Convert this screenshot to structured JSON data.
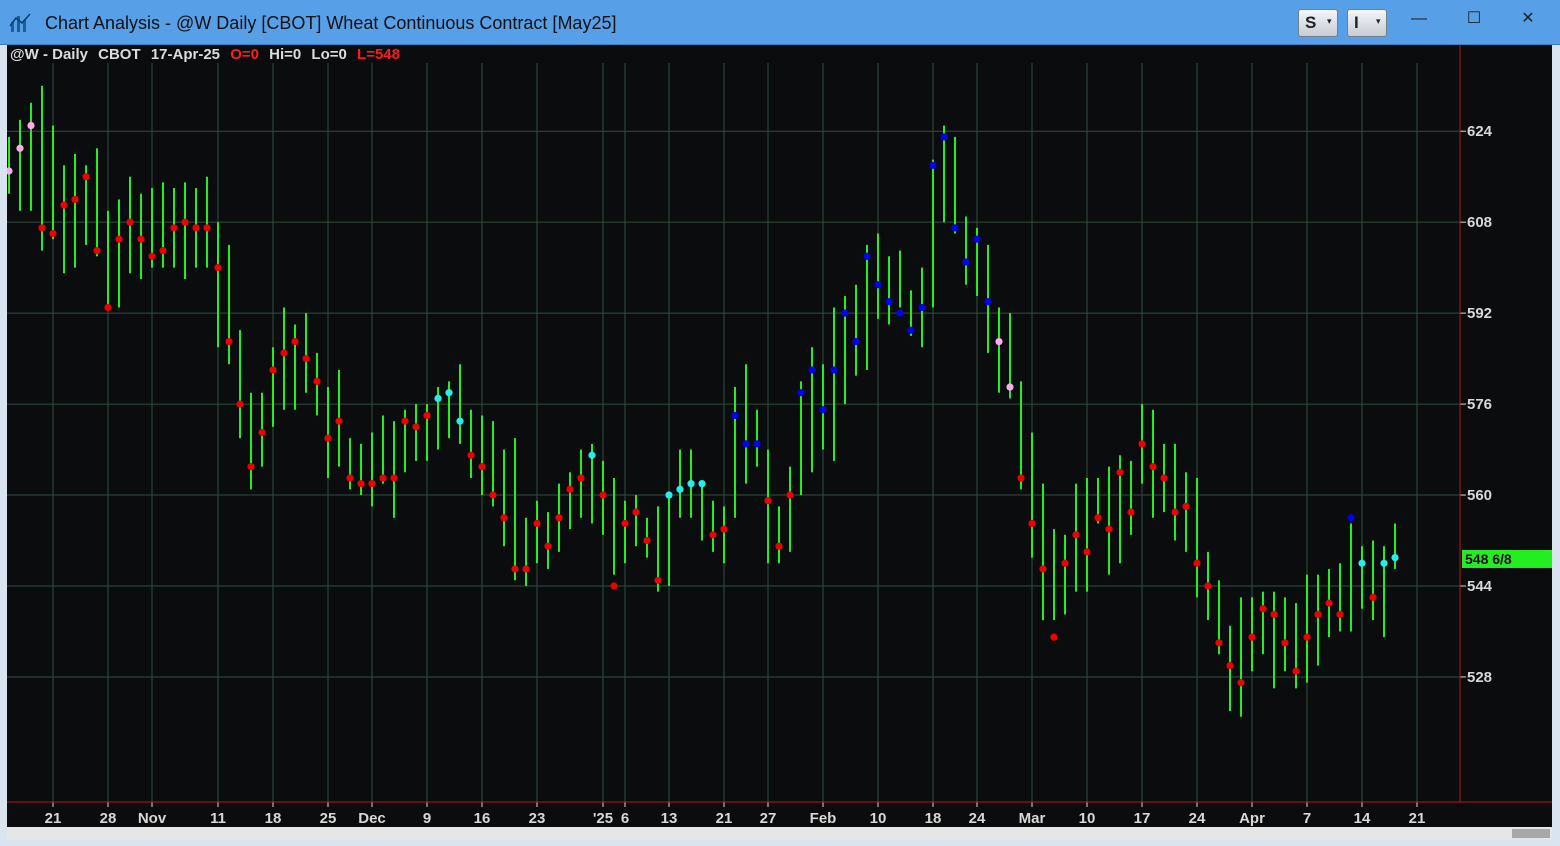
{
  "window": {
    "title": "Chart Analysis - @W Daily [CBOT] Wheat Continuous Contract [May25]",
    "toolbar_s_label": "S",
    "toolbar_i_label": "I",
    "caret": "▾",
    "minimize": "—",
    "maximize": "☐",
    "close": "✕"
  },
  "status": {
    "symbol": "@W - Daily",
    "exchange": "CBOT",
    "date": "17-Apr-25",
    "open": "O=0",
    "high": "Hi=0",
    "low": "Lo=0",
    "last": "L=548"
  },
  "colors": {
    "background": "#0b0c0d",
    "grid": "#2f4f3e",
    "bar": "#22ee22",
    "dot_red": "#ee0000",
    "dot_blue": "#0000ee",
    "dot_cyan": "#22eeee",
    "dot_pink": "#ffaaee",
    "axis_text": "#d8d8d8",
    "price_marker": "#22ee22",
    "axis_line": "#c01020"
  },
  "chart_data": {
    "type": "ohlc-bar",
    "title": "",
    "ylim": [
      506,
      636
    ],
    "y_ticks": [
      528,
      544,
      560,
      576,
      592,
      608,
      624
    ],
    "x_tick_labels": [
      {
        "label": "21",
        "bar": 4
      },
      {
        "label": "28",
        "bar": 9
      },
      {
        "label": "Nov",
        "bar": 13
      },
      {
        "label": "11",
        "bar": 19
      },
      {
        "label": "18",
        "bar": 24
      },
      {
        "label": "25",
        "bar": 29
      },
      {
        "label": "Dec",
        "bar": 33
      },
      {
        "label": "9",
        "bar": 38
      },
      {
        "label": "16",
        "bar": 43
      },
      {
        "label": "23",
        "bar": 48
      },
      {
        "label": "'25",
        "bar": 54
      },
      {
        "label": "6",
        "bar": 56
      },
      {
        "label": "13",
        "bar": 60
      },
      {
        "label": "21",
        "bar": 65
      },
      {
        "label": "27",
        "bar": 69
      },
      {
        "label": "Feb",
        "bar": 74
      },
      {
        "label": "10",
        "bar": 79
      },
      {
        "label": "18",
        "bar": 84
      },
      {
        "label": "24",
        "bar": 88
      },
      {
        "label": "Mar",
        "bar": 93
      },
      {
        "label": "10",
        "bar": 98
      },
      {
        "label": "17",
        "bar": 103
      },
      {
        "label": "24",
        "bar": 108
      },
      {
        "label": "Apr",
        "bar": 113
      },
      {
        "label": "7",
        "bar": 118
      },
      {
        "label": "14",
        "bar": 123
      },
      {
        "label": "21",
        "bar": 128
      }
    ],
    "last_price_label": "548 6/8",
    "last_price": 548.75,
    "bars": [
      [
        623,
        613,
        617,
        "pink"
      ],
      [
        626,
        610,
        621,
        "pink"
      ],
      [
        629,
        610,
        625,
        "pink"
      ],
      [
        632,
        603,
        607,
        "red"
      ],
      [
        625,
        605,
        606,
        "red"
      ],
      [
        618,
        599,
        611,
        "red"
      ],
      [
        620,
        600,
        612,
        "red"
      ],
      [
        618,
        604,
        616,
        "red"
      ],
      [
        621,
        602,
        603,
        "red"
      ],
      [
        610,
        593,
        593,
        "red"
      ],
      [
        612,
        593,
        605,
        "red"
      ],
      [
        616,
        599,
        608,
        "red"
      ],
      [
        613,
        598,
        605,
        "red"
      ],
      [
        614,
        600,
        602,
        "red"
      ],
      [
        615,
        600,
        603,
        "red"
      ],
      [
        614,
        600,
        607,
        "red"
      ],
      [
        615,
        598,
        608,
        "red"
      ],
      [
        614,
        600,
        607,
        "red"
      ],
      [
        616,
        600,
        607,
        "red"
      ],
      [
        608,
        586,
        600,
        "red"
      ],
      [
        604,
        583,
        587,
        "red"
      ],
      [
        589,
        570,
        576,
        "red"
      ],
      [
        578,
        561,
        565,
        "red"
      ],
      [
        578,
        565,
        571,
        "red"
      ],
      [
        586,
        572,
        582,
        "red"
      ],
      [
        593,
        575,
        585,
        "red"
      ],
      [
        590,
        575,
        587,
        "red"
      ],
      [
        592,
        578,
        584,
        "red"
      ],
      [
        585,
        574,
        580,
        "red"
      ],
      [
        579,
        563,
        570,
        "red"
      ],
      [
        582,
        565,
        573,
        "red"
      ],
      [
        570,
        561,
        563,
        "red"
      ],
      [
        569,
        560,
        562,
        "red"
      ],
      [
        571,
        558,
        562,
        "red"
      ],
      [
        574,
        562,
        563,
        "red"
      ],
      [
        573,
        556,
        563,
        "red"
      ],
      [
        575,
        564,
        573,
        "red"
      ],
      [
        576,
        566,
        572,
        "red"
      ],
      [
        576,
        566,
        574,
        "red"
      ],
      [
        579,
        568,
        577,
        "cyan"
      ],
      [
        580,
        570,
        578,
        "cyan"
      ],
      [
        583,
        569,
        573,
        "cyan"
      ],
      [
        575,
        563,
        567,
        "red"
      ],
      [
        574,
        560,
        565,
        "red"
      ],
      [
        573,
        558,
        560,
        "red"
      ],
      [
        568,
        551,
        556,
        "red"
      ],
      [
        570,
        545,
        547,
        "red"
      ],
      [
        556,
        544,
        547,
        "red"
      ],
      [
        559,
        548,
        555,
        "red"
      ],
      [
        557,
        547,
        551,
        "red"
      ],
      [
        562,
        550,
        556,
        "red"
      ],
      [
        564,
        554,
        561,
        "red"
      ],
      [
        568,
        556,
        563,
        "red"
      ],
      [
        569,
        555,
        567,
        "cyan"
      ],
      [
        566,
        553,
        560,
        "red"
      ],
      [
        563,
        546,
        544,
        "red"
      ],
      [
        559,
        548,
        555,
        "red"
      ],
      [
        560,
        551,
        557,
        "red"
      ],
      [
        556,
        549,
        552,
        "red"
      ],
      [
        558,
        543,
        545,
        "red"
      ],
      [
        560,
        544,
        560,
        "cyan"
      ],
      [
        568,
        556,
        561,
        "cyan"
      ],
      [
        568,
        556,
        562,
        "cyan"
      ],
      [
        562,
        552,
        562,
        "cyan"
      ],
      [
        559,
        550,
        553,
        "red"
      ],
      [
        558,
        548,
        554,
        "red"
      ],
      [
        579,
        556,
        574,
        "blue"
      ],
      [
        583,
        562,
        569,
        "blue"
      ],
      [
        575,
        565,
        569,
        "blue"
      ],
      [
        568,
        548,
        559,
        "red"
      ],
      [
        558,
        548,
        551,
        "red"
      ],
      [
        565,
        550,
        560,
        "red"
      ],
      [
        580,
        560,
        578,
        "blue"
      ],
      [
        586,
        564,
        582,
        "blue"
      ],
      [
        583,
        568,
        575,
        "blue"
      ],
      [
        593,
        566,
        582,
        "blue"
      ],
      [
        595,
        576,
        592,
        "blue"
      ],
      [
        597,
        581,
        587,
        "blue"
      ],
      [
        604,
        582,
        602,
        "blue"
      ],
      [
        606,
        591,
        597,
        "blue"
      ],
      [
        602,
        590,
        594,
        "blue"
      ],
      [
        603,
        593,
        592,
        "blue"
      ],
      [
        596,
        588,
        589,
        "blue"
      ],
      [
        600,
        586,
        593,
        "blue"
      ],
      [
        619,
        593,
        618,
        "blue"
      ],
      [
        625,
        608,
        623,
        "blue"
      ],
      [
        623,
        606,
        607,
        "blue"
      ],
      [
        609,
        597,
        601,
        "blue"
      ],
      [
        607,
        595,
        605,
        "blue"
      ],
      [
        604,
        585,
        594,
        "blue"
      ],
      [
        593,
        578,
        587,
        "pink"
      ],
      [
        592,
        577,
        579,
        "pink"
      ],
      [
        580,
        561,
        563,
        "red"
      ],
      [
        571,
        549,
        555,
        "red"
      ],
      [
        562,
        538,
        547,
        "red"
      ],
      [
        554,
        538,
        535,
        "red"
      ],
      [
        553,
        539,
        548,
        "red"
      ],
      [
        562,
        543,
        553,
        "red"
      ],
      [
        563,
        543,
        550,
        "red"
      ],
      [
        563,
        555,
        556,
        "red"
      ],
      [
        565,
        546,
        554,
        "red"
      ],
      [
        567,
        548,
        564,
        "red"
      ],
      [
        566,
        553,
        557,
        "red"
      ],
      [
        576,
        562,
        569,
        "red"
      ],
      [
        575,
        556,
        565,
        "red"
      ],
      [
        569,
        557,
        563,
        "red"
      ],
      [
        569,
        552,
        557,
        "red"
      ],
      [
        564,
        550,
        558,
        "red"
      ],
      [
        563,
        542,
        548,
        "red"
      ],
      [
        550,
        538,
        544,
        "red"
      ],
      [
        545,
        532,
        534,
        "red"
      ],
      [
        537,
        522,
        530,
        "red"
      ],
      [
        542,
        521,
        527,
        "red"
      ],
      [
        542,
        529,
        535,
        "red"
      ],
      [
        543,
        532,
        540,
        "red"
      ],
      [
        543,
        526,
        539,
        "red"
      ],
      [
        542,
        529,
        534,
        "red"
      ],
      [
        541,
        526,
        529,
        "red"
      ],
      [
        546,
        527,
        535,
        "red"
      ],
      [
        546,
        530,
        539,
        "red"
      ],
      [
        547,
        535,
        541,
        "red"
      ],
      [
        548,
        536,
        539,
        "red"
      ],
      [
        555,
        536,
        556,
        "blue"
      ],
      [
        551,
        540,
        548,
        "cyan"
      ],
      [
        552,
        538,
        542,
        "red"
      ],
      [
        551,
        535,
        548,
        "cyan"
      ],
      [
        555,
        547,
        549,
        "cyan"
      ]
    ]
  }
}
